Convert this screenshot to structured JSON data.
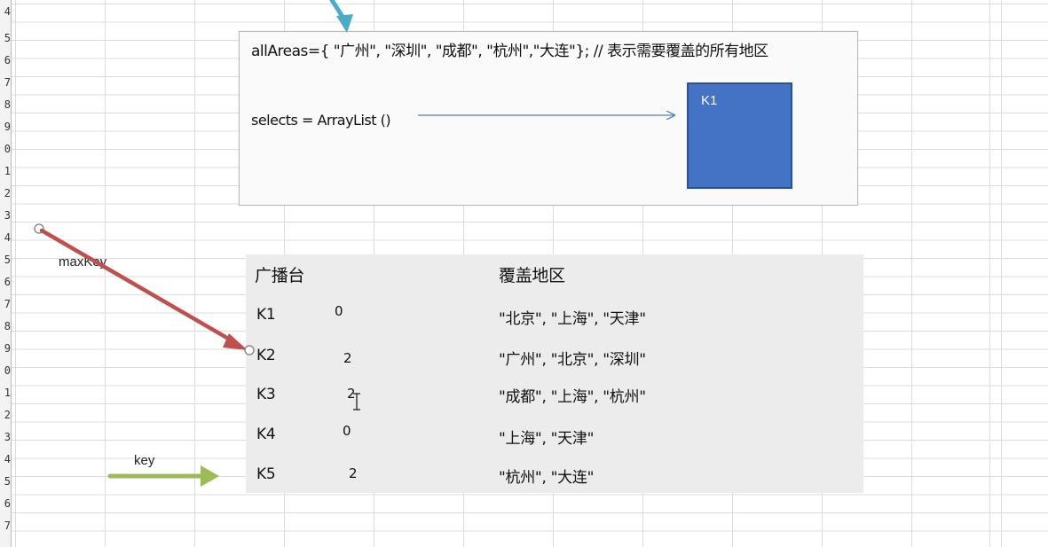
{
  "row_numbers": [
    "4",
    "5",
    "6",
    "7",
    "8",
    "9",
    "0",
    "1",
    "2",
    "3",
    "4",
    "5",
    "6",
    "7",
    "8",
    "9",
    "0",
    "1",
    "2",
    "3",
    "4",
    "5",
    "6",
    "7"
  ],
  "code_box": {
    "line1": "allAreas={ \"广州\",  \"深圳\", \"成都\", \"杭州\",\"大连\"}; // 表示需要覆盖的所有地区",
    "line2": "selects = ArrayList ()"
  },
  "k1_box": {
    "label": "K1"
  },
  "table": {
    "header": {
      "col1": "广播台",
      "col2": "覆盖地区"
    },
    "rows": [
      {
        "key": "K1",
        "count": "0",
        "areas": "\"北京\", \"上海\", \"天津\""
      },
      {
        "key": "K2",
        "count": "2",
        "areas": "\"广州\", \"北京\", \"深圳\""
      },
      {
        "key": "K3",
        "count": "2",
        "areas": "\"成都\", \"上海\", \"杭州\""
      },
      {
        "key": "K4",
        "count": "0",
        "areas": "\"上海\", \"天津\""
      },
      {
        "key": "K5",
        "count": "2",
        "areas": "\"杭州\", \"大连\""
      }
    ]
  },
  "labels": {
    "max_key": "maxKey",
    "key": "key"
  },
  "colors": {
    "red_arrow": "#c0504d",
    "green_arrow": "#9bbb59",
    "teal_arrow": "#4aacc6",
    "blue_arrow": "#4f81bd",
    "k1_fill": "#4472c4"
  }
}
